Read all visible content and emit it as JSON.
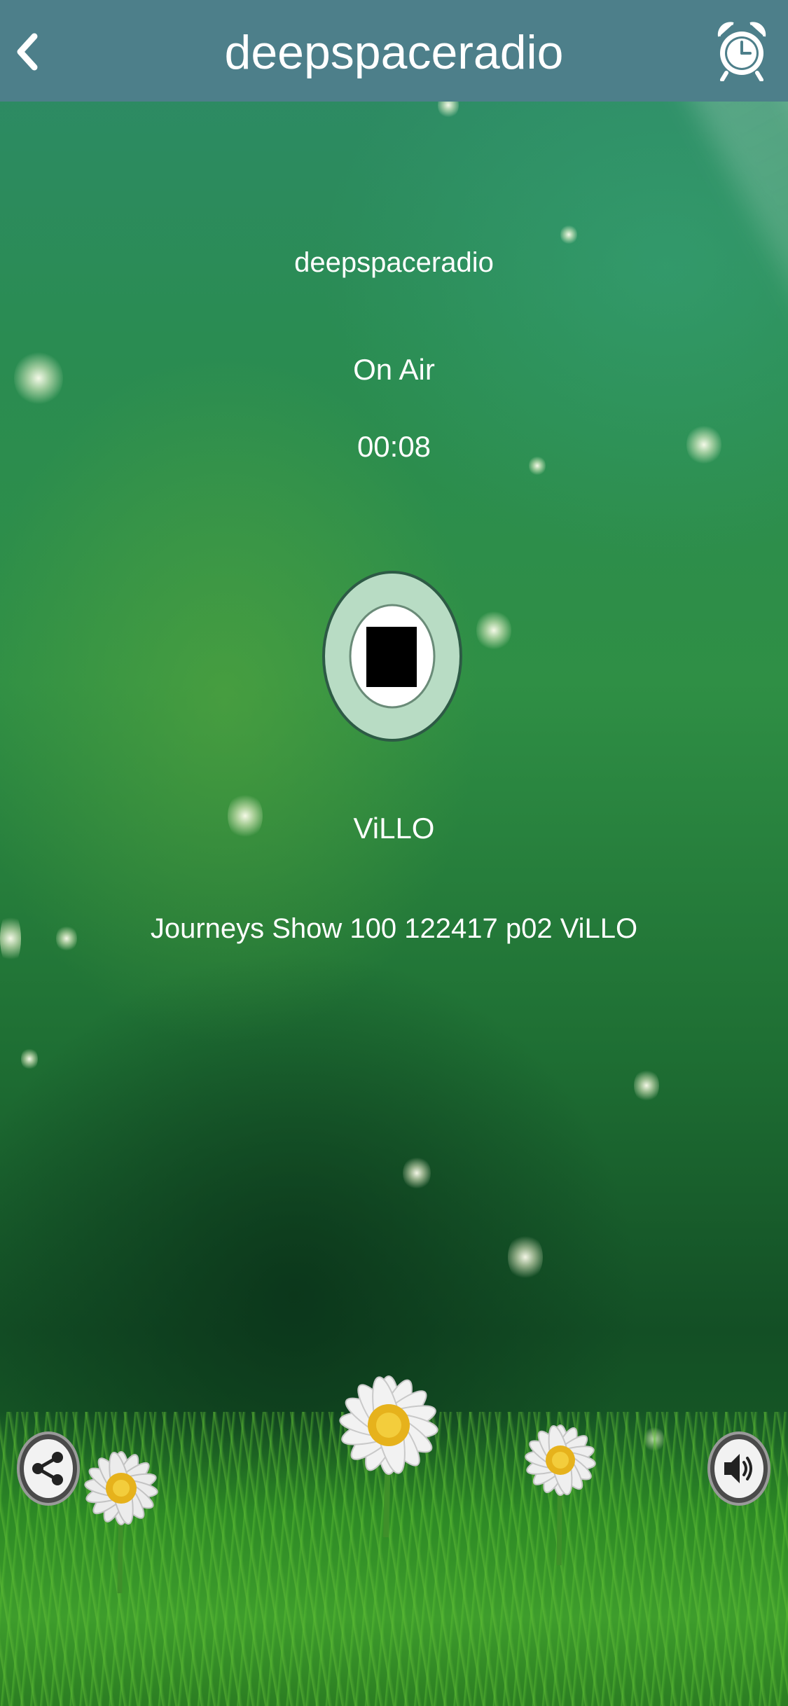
{
  "header": {
    "title": "deepspaceradio"
  },
  "player": {
    "station_name": "deepspaceradio",
    "status": "On Air",
    "elapsed": "00:08",
    "artist": "ViLLO",
    "track": "Journeys Show 100 122417 p02 ViLLO"
  },
  "icons": {
    "back": "chevron-left-icon",
    "alarm": "alarm-clock-icon",
    "stop": "stop-icon",
    "share": "share-icon",
    "volume": "speaker-icon"
  },
  "colors": {
    "navbar": "#4d7f8a",
    "stop_ring": "#b8dcc4",
    "stop_square": "#000000"
  }
}
